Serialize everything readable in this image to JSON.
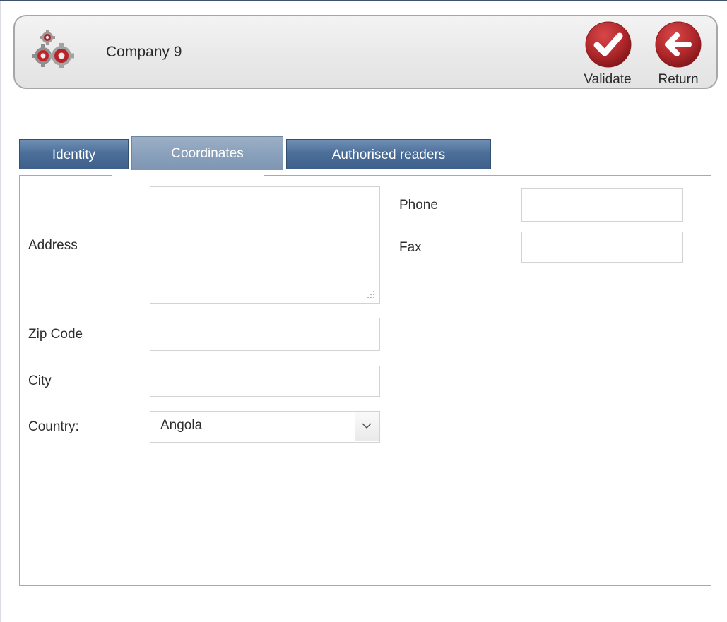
{
  "header": {
    "icon": "gears-icon",
    "title": "Company 9",
    "actions": {
      "validate": {
        "label": "Validate",
        "icon": "checkmark-circle-icon",
        "color": "#b0282b"
      },
      "return": {
        "label": "Return",
        "icon": "arrow-left-circle-icon",
        "color": "#b0282b"
      }
    }
  },
  "tabs": [
    {
      "label": "Identity",
      "active": false
    },
    {
      "label": "Coordinates",
      "active": true
    },
    {
      "label": "Authorised readers",
      "active": false
    }
  ],
  "form": {
    "address": {
      "label": "Address",
      "value": ""
    },
    "zip_code": {
      "label": "Zip Code",
      "value": ""
    },
    "city": {
      "label": "City",
      "value": ""
    },
    "country": {
      "label": "Country:",
      "value": "Angola"
    },
    "phone": {
      "label": "Phone",
      "value": ""
    },
    "fax": {
      "label": "Fax",
      "value": ""
    }
  },
  "colors": {
    "tab_blue": "#4c6f9a",
    "tab_active": "#8aa1bc",
    "action_red": "#b0282b"
  }
}
